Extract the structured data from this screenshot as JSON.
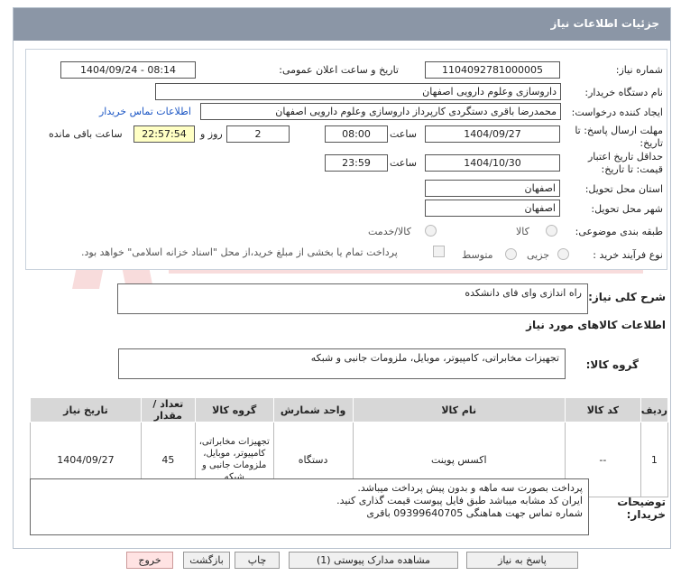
{
  "header": {
    "title": "جزئیات اطلاعات نیاز"
  },
  "form": {
    "need_number_label": "شماره نیاز:",
    "need_number": "1104092781000005",
    "announce_label": "تاریخ و ساعت اعلان عمومی:",
    "announce_value": "1404/09/24 - 08:14",
    "buyer_label": "نام دستگاه خریدار:",
    "buyer_value": "داروسازی وعلوم دارویی اصفهان",
    "creator_label": "ایجاد کننده درخواست:",
    "creator_value": "محمدرضا باقری دستگردی کارپرداز داروسازی وعلوم دارویی اصفهان",
    "contact_link": "اطلاعات تماس خریدار",
    "deadline_label_1": "مهلت ارسال پاسخ: تا",
    "deadline_label_2": "تاریخ:",
    "deadline_date": "1404/09/27",
    "time_label": "ساعت",
    "deadline_time": "08:00",
    "days_value": "2",
    "days_label": "روز و",
    "remaining_time": "22:57:54",
    "remaining_label": "ساعت باقی مانده",
    "validity_label_1": "حداقل تاریخ اعتبار",
    "validity_label_2": "قیمت: تا تاریخ:",
    "validity_date": "1404/10/30",
    "validity_time_label": "ساعت",
    "validity_time": "23:59",
    "province_label": "استان محل تحویل:",
    "province_value": "اصفهان",
    "city_label": "شهر محل تحویل:",
    "city_value": "اصفهان",
    "category_label": "طبقه بندی موضوعی:",
    "category_options": [
      "کالا",
      "کالا/خدمت"
    ],
    "process_label": "نوع فرآیند خرید :",
    "process_options": [
      "جزیی",
      "متوسط"
    ],
    "payment_note": "پرداخت تمام یا بخشی از مبلغ خرید،از محل \"اسناد خزانه اسلامی\" خواهد بود."
  },
  "description": {
    "label": "شرح کلی نیاز:",
    "value": "راه اندازی وای فای دانشکده"
  },
  "goods_info": {
    "title": "اطلاعات کالاهای مورد نیاز",
    "group_label": "گروه کالا:",
    "group_value": "تجهیزات مخابراتی، کامپیوتر، موبایل، ملزومات جانبی و شبکه"
  },
  "table": {
    "headers": [
      "ردیف",
      "کد کالا",
      "نام کالا",
      "واحد شمارش",
      "گروه کالا",
      "تعداد / مقدار",
      "تاریخ نیاز"
    ],
    "rows": [
      [
        "1",
        "--",
        "اکسس پوینت",
        "دستگاه",
        "تجهیزات مخابراتی، کامپیوتر، موبایل، ملزومات جانبی و شبکه",
        "45",
        "1404/09/27"
      ]
    ]
  },
  "buyer_notes": {
    "label_1": "توضیحات",
    "label_2": "خریدار:",
    "lines": [
      "پرداخت بصورت سه ماهه و بدون پیش پرداخت میباشد.",
      "ایران کد مشابه میباشد طبق فایل پیوست قیمت گذاری کنید.",
      "شماره تماس جهت هماهنگی 09399640705 باقری"
    ]
  },
  "buttons": {
    "reply": "پاسخ به نیاز",
    "attachments": "مشاهده مدارک پیوستی (1)",
    "print": "چاپ",
    "back": "بازگشت",
    "exit": "خروج"
  },
  "colors": {
    "titlebar": "#8b96a6",
    "highlight": "#ffffc4",
    "link": "#1a55c4",
    "exit_button": "#ffe3e3"
  }
}
